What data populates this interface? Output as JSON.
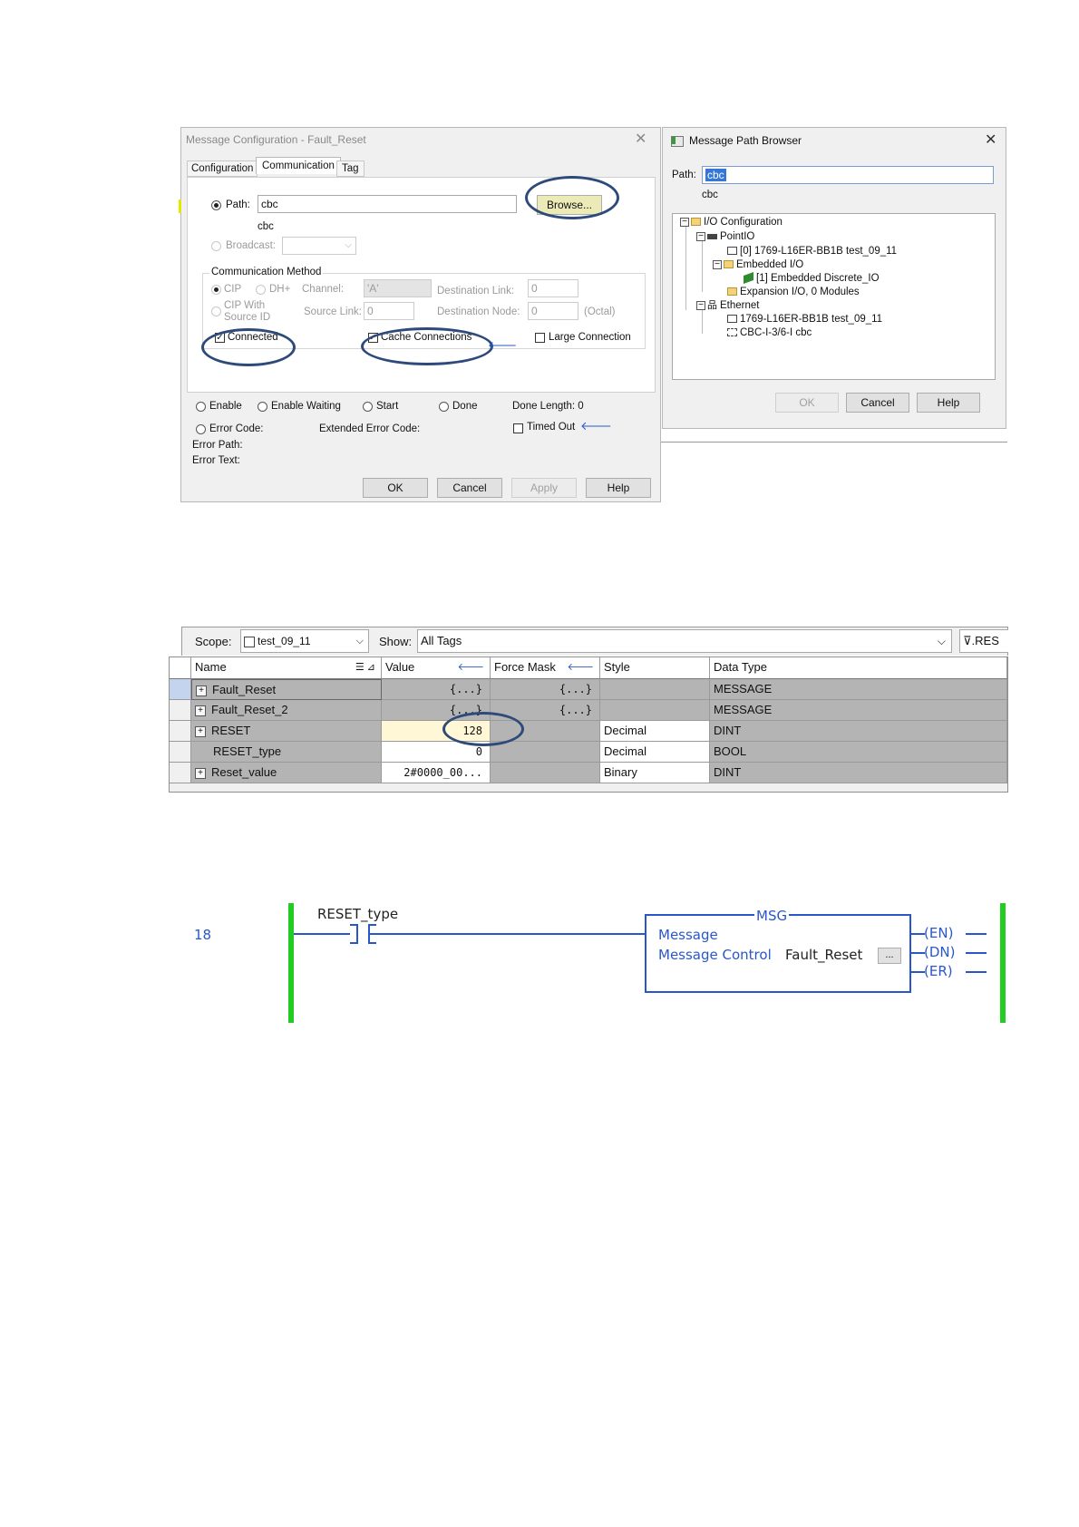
{
  "msgcfg": {
    "title": "Message Configuration - Fault_Reset",
    "tabs": [
      "Configuration",
      "Communication",
      "Tag"
    ],
    "path_label": "Path:",
    "path_value": "cbc",
    "path_text": "cbc",
    "browse": "Browse...",
    "broadcast_label": "Broadcast:",
    "comm_method": "Communication Method",
    "cip": "CIP",
    "dhplus": "DH+",
    "channel_label": "Channel:",
    "channel_value": "'A'",
    "dest_link_label": "Destination Link:",
    "dest_link_value": "0",
    "cip_with": "CIP With",
    "source_id": "Source ID",
    "source_link_label": "Source Link:",
    "source_link_value": "0",
    "dest_node_label": "Destination Node:",
    "dest_node_value": "0",
    "octal": "(Octal)",
    "connected": "Connected",
    "cache": "Cache Connections",
    "large": "Large Connection",
    "enable": "Enable",
    "enable_waiting": "Enable Waiting",
    "start": "Start",
    "done": "Done",
    "done_length": "Done Length:",
    "done_length_value": "0",
    "error_code": "Error Code:",
    "ext_error": "Extended Error Code:",
    "timed_out": "Timed Out",
    "error_path": "Error Path:",
    "error_text": "Error Text:",
    "ok": "OK",
    "cancel": "Cancel",
    "apply": "Apply",
    "help": "Help"
  },
  "browser": {
    "title": "Message Path Browser",
    "path_label": "Path:",
    "path_value": "cbc",
    "path_text": "cbc",
    "tree": {
      "io": "I/O Configuration",
      "pointio": "PointIO",
      "controller": "[0] 1769-L16ER-BB1B test_09_11",
      "embedded": "Embedded I/O",
      "discrete": "[1] Embedded Discrete_IO",
      "expansion": "Expansion I/O, 0 Modules",
      "ethernet": "Ethernet",
      "eth_ctrl": "1769-L16ER-BB1B test_09_11",
      "cbc": "CBC-I-3/6-I cbc"
    },
    "ok": "OK",
    "cancel": "Cancel",
    "help": "Help"
  },
  "tags": {
    "scope_label": "Scope:",
    "scope_value": "test_09_11",
    "show_label": "Show:",
    "show_value": "All Tags",
    "filter_label": "RES",
    "headers": [
      "Name",
      "Value",
      "Force Mask",
      "Style",
      "Data Type"
    ],
    "rows": [
      {
        "name": "Fault_Reset",
        "value": "{...}",
        "force": "{...}",
        "style": "",
        "type": "MESSAGE"
      },
      {
        "name": "Fault_Reset_2",
        "value": "{...}",
        "force": "{...}",
        "style": "",
        "type": "MESSAGE"
      },
      {
        "name": "RESET",
        "value": "128",
        "force": "",
        "style": "Decimal",
        "type": "DINT"
      },
      {
        "name": "RESET_type",
        "value": "0",
        "force": "",
        "style": "Decimal",
        "type": "BOOL"
      },
      {
        "name": "Reset_value",
        "value": "2#0000_00...",
        "force": "",
        "style": "Binary",
        "type": "DINT"
      }
    ]
  },
  "ladder": {
    "rung": "18",
    "contact_tag": "RESET_type",
    "msg_title": "MSG",
    "msg_line1": "Message",
    "msg_line2": "Message Control",
    "msg_tag": "Fault_Reset",
    "ellipsis": "...",
    "outputs": [
      "EN",
      "DN",
      "ER"
    ],
    "colors": {
      "rail": "#22cc22",
      "text": "#2a57c8",
      "wire": "#2a57c8"
    }
  }
}
